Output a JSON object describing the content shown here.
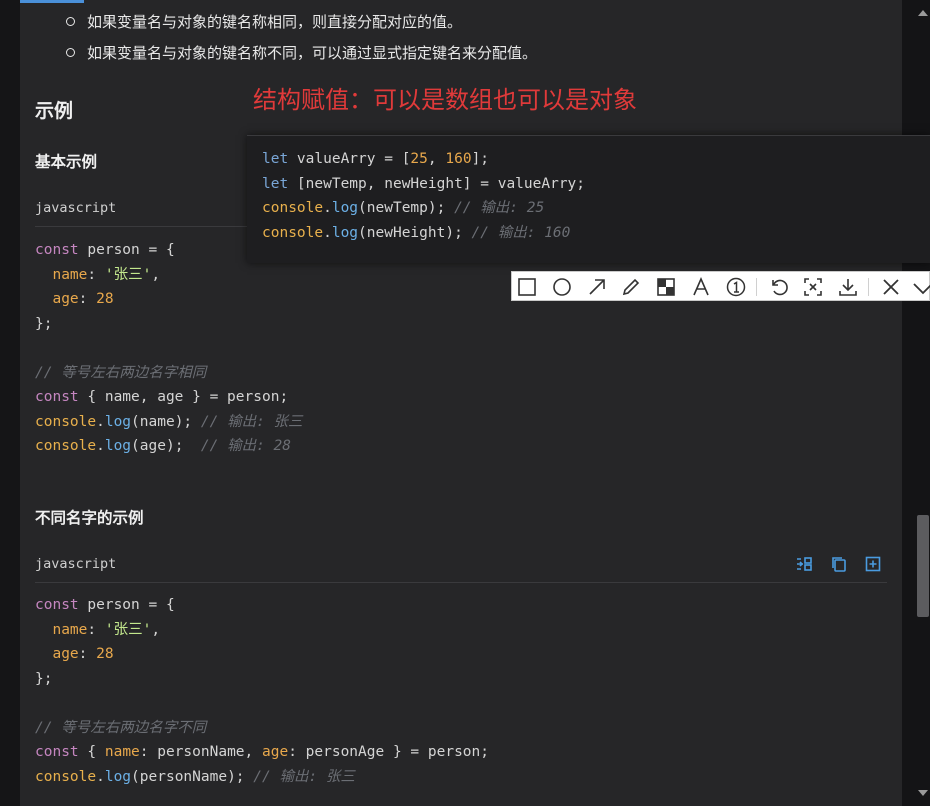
{
  "bullets": [
    "如果变量名与对象的键名称相同，则直接分配对应的值。",
    "如果变量名与对象的键名称不同，可以通过显式指定键名来分配值。"
  ],
  "section_title": "示例",
  "annotation": "结构赋值：可以是数组也可以是对象",
  "popup_code": {
    "line1": {
      "kw": "let",
      "name": " valueArry = [",
      "n1": "25",
      "comma": ", ",
      "n2": "160",
      "end": "];"
    },
    "line2": {
      "kw": "let",
      "rest": " [newTemp, newHeight] = valueArry;"
    },
    "line3": {
      "obj": "console",
      "dot": ".",
      "fn": "log",
      "args": "(newTemp); ",
      "cmt": "// 输出: 25"
    },
    "line4": {
      "obj": "console",
      "dot": ".",
      "fn": "log",
      "args": "(newHeight); ",
      "cmt": "// 输出: 160"
    }
  },
  "example1": {
    "title": "基本示例",
    "lang": "javascript",
    "code": {
      "l1_kw": "const",
      "l1_rest": " person = {",
      "l2_prop": "  name",
      "l2_colon": ": ",
      "l2_str": "'张三'",
      "l2_end": ",",
      "l3_prop": "  age",
      "l3_colon": ": ",
      "l3_num": "28",
      "l4": "};",
      "l6_cmt": "// 等号左右两边名字相同",
      "l7_kw": "const",
      "l7_rest": " { name, age } = person;",
      "l8_obj": "console",
      "l8_dot": ".",
      "l8_fn": "log",
      "l8_args": "(name); ",
      "l8_cmt": "// 输出: 张三",
      "l9_obj": "console",
      "l9_dot": ".",
      "l9_fn": "log",
      "l9_args": "(age);  ",
      "l9_cmt": "// 输出: 28"
    }
  },
  "example2": {
    "title": "不同名字的示例",
    "lang": "javascript",
    "code": {
      "l1_kw": "const",
      "l1_rest": " person = {",
      "l2_prop": "  name",
      "l2_colon": ": ",
      "l2_str": "'张三'",
      "l2_end": ",",
      "l3_prop": "  age",
      "l3_colon": ": ",
      "l3_num": "28",
      "l4": "};",
      "l6_cmt": "// 等号左右两边名字不同",
      "l7_kw": "const",
      "l7_a": " { ",
      "l7_p1": "name",
      "l7_b": ": personName, ",
      "l7_p2": "age",
      "l7_c": ": personAge } = person;",
      "l8_obj": "console",
      "l8_dot": ".",
      "l8_fn": "log",
      "l8_args": "(personName); ",
      "l8_cmt": "// 输出: 张三"
    }
  },
  "code_actions": [
    "wrap-icon",
    "copy-icon",
    "expand-icon"
  ],
  "toolbar_tools": [
    "rectangle-icon",
    "ellipse-icon",
    "arrow-icon",
    "pen-icon",
    "mosaic-icon",
    "text-icon",
    "number-icon",
    "undo-icon",
    "ocr-icon",
    "download-icon",
    "close-icon",
    "confirm-icon"
  ]
}
